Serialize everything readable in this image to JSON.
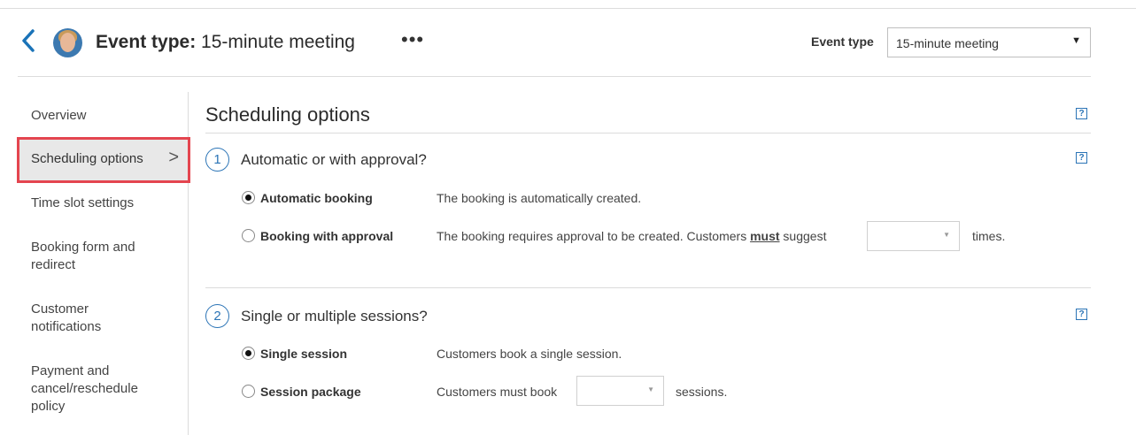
{
  "header": {
    "back_icon": "chevron-left-icon",
    "title_prefix": "Event type:",
    "title_value": " 15-minute meeting",
    "more_icon": "•••",
    "event_type_label": "Event type",
    "event_type_value": "15-minute meeting",
    "dropdown_arrow": "▼"
  },
  "sidebar": {
    "items": [
      {
        "label": "Overview"
      },
      {
        "label": "Scheduling options",
        "active": true
      },
      {
        "label": "Time slot settings"
      },
      {
        "label": "Booking form and redirect"
      },
      {
        "label": "Customer notifications"
      },
      {
        "label": "Payment and cancel/reschedule policy"
      }
    ],
    "chevron": ">"
  },
  "main": {
    "title": "Scheduling options",
    "help": "?",
    "sections": [
      {
        "number": "1",
        "question": "Automatic or with approval?",
        "options": [
          {
            "label": "Automatic booking",
            "selected": true,
            "description": "The booking is automatically created."
          },
          {
            "label": "Booking with approval",
            "selected": false,
            "description_before": "The booking requires approval to be created. Customers ",
            "description_emphasis": "must",
            "description_middle": " suggest",
            "description_after": "times.",
            "select_value": "",
            "select_arrow": "▼"
          }
        ]
      },
      {
        "number": "2",
        "question": "Single or multiple sessions?",
        "options": [
          {
            "label": "Single session",
            "selected": true,
            "description": "Customers book a single session."
          },
          {
            "label": "Session package",
            "selected": false,
            "description_before": "Customers must book",
            "description_after": "sessions.",
            "select_value": "",
            "select_arrow": "▼"
          }
        ]
      }
    ]
  },
  "colors": {
    "accent": "#2b74b6",
    "active_highlight": "#e4454f",
    "active_bg": "#e8e8e8"
  }
}
